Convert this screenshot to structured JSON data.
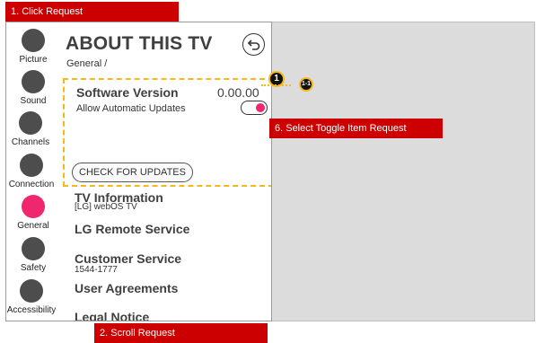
{
  "requests": {
    "click": "1. Click Request",
    "scroll": "2. Scroll Request",
    "toggle": "6. Select Toggle Item Request"
  },
  "badges": {
    "main": "1",
    "sub": "1-1"
  },
  "sidebar": {
    "items": [
      {
        "label": "Picture",
        "active": false
      },
      {
        "label": "Sound",
        "active": false
      },
      {
        "label": "Channels",
        "active": false
      },
      {
        "label": "Connection",
        "active": false
      },
      {
        "label": "General",
        "active": true
      },
      {
        "label": "Safety",
        "active": false
      },
      {
        "label": "Accessibility",
        "active": false
      }
    ]
  },
  "header": {
    "title": "ABOUT THIS TV",
    "breadcrumb": "General /"
  },
  "software": {
    "title": "Software Version",
    "version": "0.00.00",
    "auto_update_label": "Allow Automatic Updates",
    "auto_update_on": true,
    "check_button": "CHECK FOR UPDATES"
  },
  "sections": {
    "tv_info": {
      "title": "TV Information",
      "value": "[LG] webOS TV"
    },
    "remote": {
      "title": "LG Remote Service"
    },
    "customer": {
      "title": "Customer Service",
      "value": "1544-1777"
    },
    "agreements": {
      "title": "User Agreements"
    },
    "legal": {
      "title": "Legal Notice"
    }
  },
  "colors": {
    "accent": "#f0266f",
    "banner": "#cc0000",
    "highlight": "#f4b91a",
    "dot": "#4d4d4d"
  }
}
